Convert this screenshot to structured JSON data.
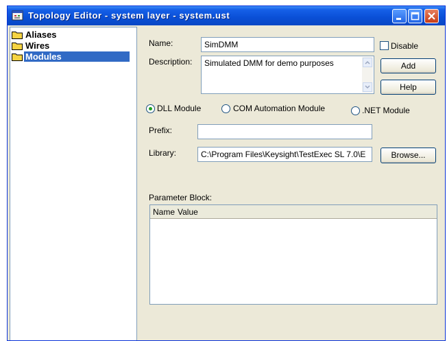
{
  "window": {
    "title": "Topology Editor - system layer - system.ust"
  },
  "tree": {
    "items": [
      {
        "label": "Aliases",
        "selected": false
      },
      {
        "label": "Wires",
        "selected": false
      },
      {
        "label": "Modules",
        "selected": true
      }
    ]
  },
  "form": {
    "name_label": "Name:",
    "name_value": "SimDMM",
    "description_label": "Description:",
    "description_value": "Simulated DMM for demo purposes",
    "disable_label": "Disable",
    "disable_checked": false,
    "add_label": "Add",
    "help_label": "Help",
    "module_types": [
      {
        "label": "DLL Module",
        "selected": true
      },
      {
        "label": "COM Automation Module",
        "selected": false
      },
      {
        "label": ".NET Module",
        "selected": false
      }
    ],
    "prefix_label": "Prefix:",
    "prefix_value": "",
    "library_label": "Library:",
    "library_value": "C:\\Program Files\\Keysight\\TestExec SL 7.0\\E",
    "browse_label": "Browse...",
    "parameter_block_label": "Parameter Block:",
    "grid_columns": [
      "Name",
      "Value"
    ]
  }
}
